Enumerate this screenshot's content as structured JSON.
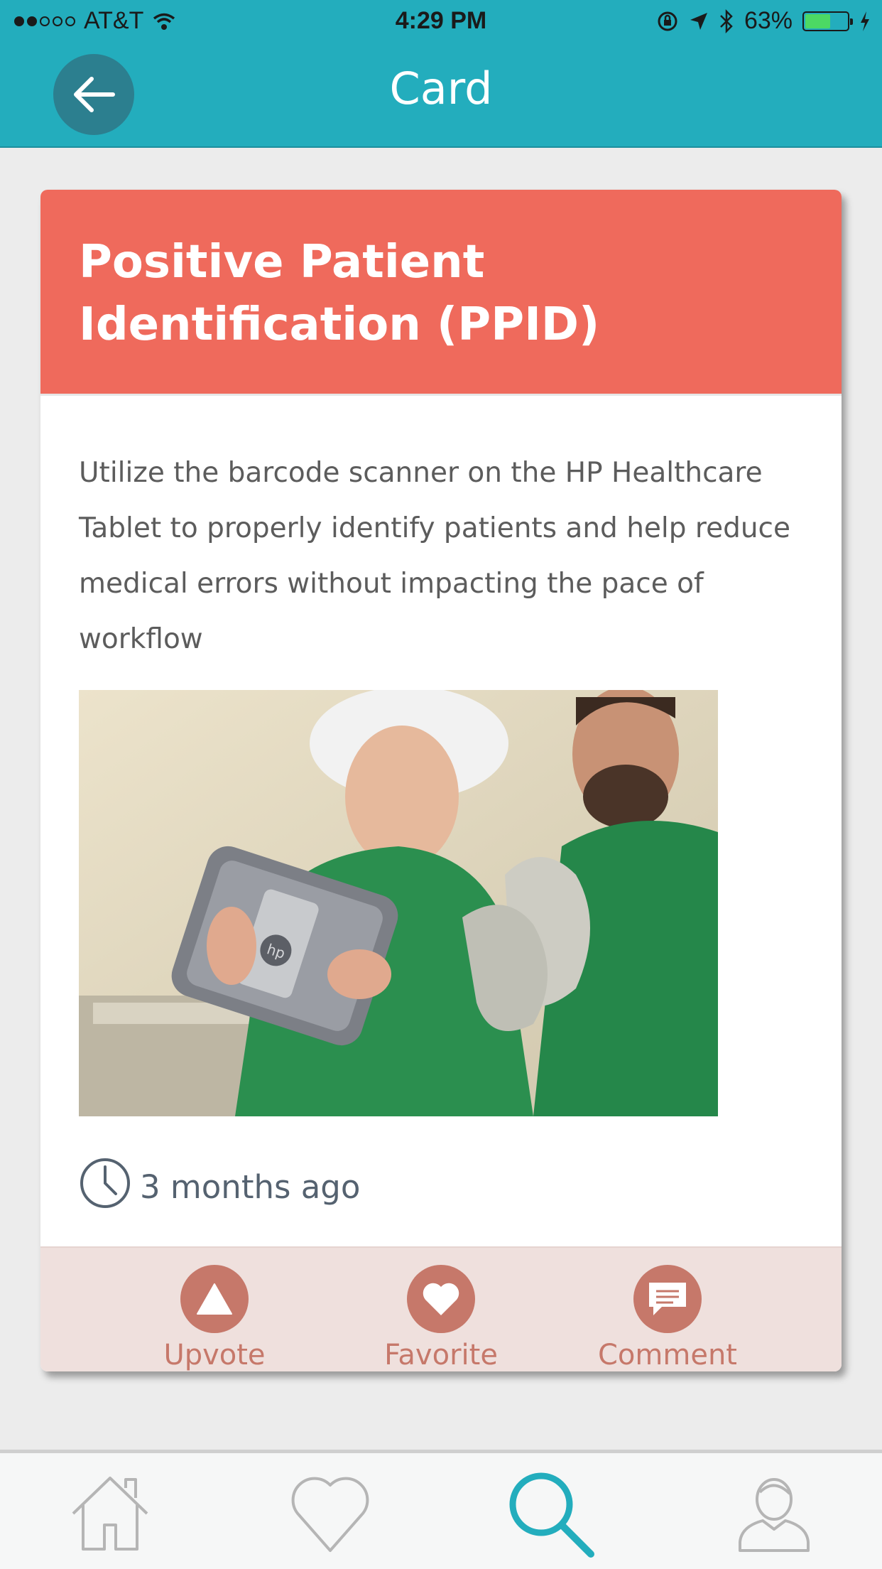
{
  "status_bar": {
    "carrier": "AT&T",
    "time": "4:29 PM",
    "battery": "63%",
    "battery_level": 0.63
  },
  "header": {
    "title": "Card",
    "back_icon": "arrow-left-icon"
  },
  "card": {
    "title": "Positive Patient Identification (PPID)",
    "description": "Utilize the barcode scanner on the HP Healthcare Tablet to properly identify patients and help reduce medical errors without impacting the pace of workflow",
    "time_ago": "3 months ago",
    "colors": {
      "header": "#ef6a5c",
      "action": "#c6786a",
      "action_bg": "#efe0dd"
    }
  },
  "actions": [
    {
      "label": "Upvote",
      "icon": "triangle-up-icon"
    },
    {
      "label": "Favorite",
      "icon": "heart-icon"
    },
    {
      "label": "Comment",
      "icon": "comment-icon"
    }
  ],
  "tabbar": {
    "tabs": [
      {
        "icon": "home-icon",
        "active": false
      },
      {
        "icon": "heart-outline-icon",
        "active": false
      },
      {
        "icon": "search-icon",
        "active": true
      },
      {
        "icon": "profile-icon",
        "active": false
      }
    ],
    "active_color": "#23adbd",
    "inactive_color": "#b5b5b5"
  }
}
